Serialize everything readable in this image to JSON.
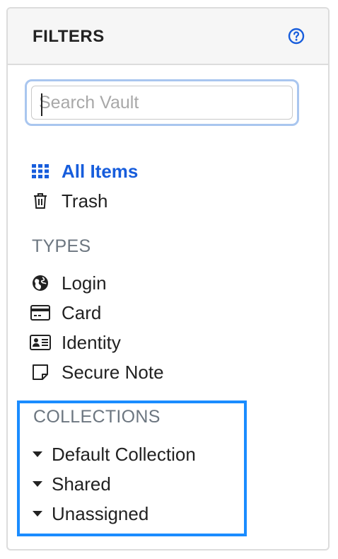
{
  "header": {
    "title": "FILTERS",
    "help_icon": "question-circle-icon"
  },
  "search": {
    "placeholder": "Search Vault",
    "value": ""
  },
  "main_filters": [
    {
      "label": "All Items",
      "icon": "grid-icon",
      "active": true
    },
    {
      "label": "Trash",
      "icon": "trash-icon",
      "active": false
    }
  ],
  "types": {
    "heading": "TYPES",
    "items": [
      {
        "label": "Login",
        "icon": "globe-icon"
      },
      {
        "label": "Card",
        "icon": "credit-card-icon"
      },
      {
        "label": "Identity",
        "icon": "id-card-icon"
      },
      {
        "label": "Secure Note",
        "icon": "sticky-note-icon"
      }
    ]
  },
  "collections": {
    "heading": "COLLECTIONS",
    "items": [
      {
        "label": "Default Collection",
        "icon": "caret-down-icon"
      },
      {
        "label": "Shared",
        "icon": "caret-down-icon"
      },
      {
        "label": "Unassigned",
        "icon": "caret-down-icon"
      }
    ]
  },
  "colors": {
    "accent": "#175ddc",
    "highlight_border": "#1a8cff",
    "muted": "#6c7680"
  }
}
